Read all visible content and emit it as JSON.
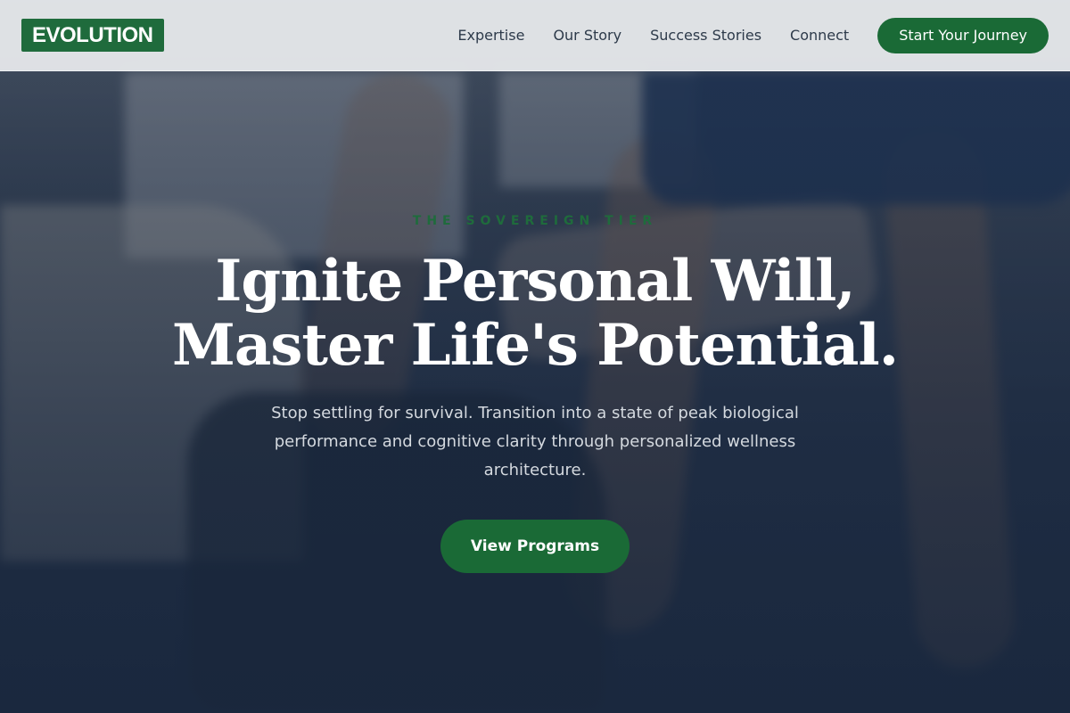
{
  "brand": {
    "logo": "EVOLUTION",
    "accent": "#1a6a36"
  },
  "nav": {
    "items": [
      "Expertise",
      "Our Story",
      "Success Stories",
      "Connect"
    ],
    "cta": "Start Your Journey"
  },
  "hero": {
    "eyebrow": "THE SOVEREIGN TIER",
    "headline_line1": "Ignite Personal Will,",
    "headline_line2": "Master Life's Potential.",
    "subtitle": "Stop settling for survival. Transition into a state of peak biological performance and cognitive clarity through personalized wellness architecture.",
    "button": "View Programs"
  }
}
